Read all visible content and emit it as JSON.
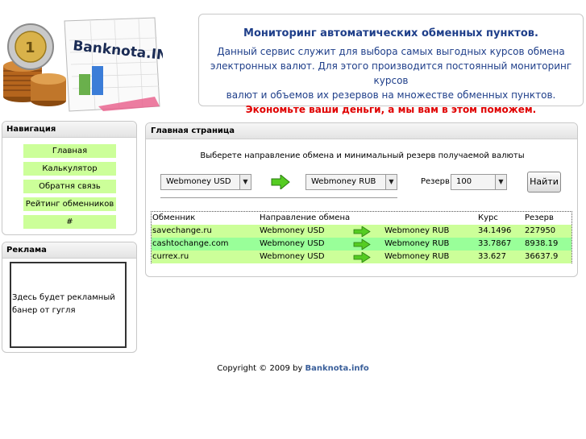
{
  "logo": {
    "text": "Banknota.INFO"
  },
  "header": {
    "title": "Мониторинг автоматических обменных пунктов.",
    "desc_lines": [
      "Данный сервис служит для выбора самых выгодных курсов обмена",
      "электронных валют. Для этого производится постоянный мониторинг курсов",
      "валют и объемов их резервов на множестве обменных пунктов."
    ],
    "slogan": "Экономьте ваши деньги, а мы вам в этом поможем."
  },
  "nav": {
    "title": "Навигация",
    "items": [
      "Главная",
      "Калькулятор",
      "Обратня связь",
      "Рейтинг обменников",
      "#"
    ]
  },
  "ad": {
    "title": "Реклама",
    "banner_text": "Здесь будет рекламный банер от гугля"
  },
  "main": {
    "title": "Главная страница",
    "lead": "Выберете направление обмена и минимальный резерв получаемой валюты",
    "from_currency": "Webmoney USD",
    "to_currency": "Webmoney RUB",
    "reserve_label": "Резерв",
    "reserve_value": "100",
    "find_button": "Найти"
  },
  "table": {
    "headers": [
      "Обменник",
      "Направление обмена",
      "",
      "Курс",
      "Резерв"
    ],
    "rows": [
      {
        "exchanger": "savechange.ru",
        "from": "Webmoney USD",
        "to": "Webmoney RUB",
        "rate": "34.1496",
        "reserve": "227950"
      },
      {
        "exchanger": "cashtochange.com",
        "from": "Webmoney USD",
        "to": "Webmoney RUB",
        "rate": "33.7867",
        "reserve": "8938.19"
      },
      {
        "exchanger": "currex.ru",
        "from": "Webmoney USD",
        "to": "Webmoney RUB",
        "rate": "33.627",
        "reserve": "36637.9"
      }
    ]
  },
  "footer": {
    "prefix": "Copyright © 2009 by",
    "brand": "Banknota.info"
  },
  "colors": {
    "title_blue": "#1f3f8a",
    "slogan_red": "#e00000",
    "row_light_green": "#ccff99",
    "row_green": "#99ff99"
  }
}
